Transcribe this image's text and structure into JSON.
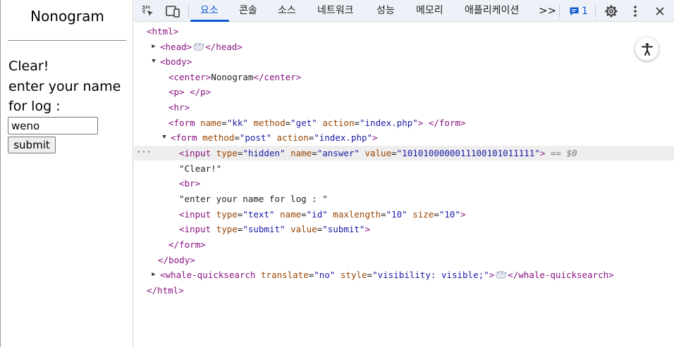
{
  "page": {
    "title": "Nonogram",
    "status": "Clear!",
    "prompt_line1": "enter your name",
    "prompt_line2": "for log :",
    "name_value": "weno",
    "submit_label": "submit"
  },
  "devtools": {
    "tabs": [
      "요소",
      "콘솔",
      "소스",
      "네트워크",
      "성능",
      "메모리",
      "애플리케이션"
    ],
    "active_tab": "요소",
    "more_tabs_icon": ">>",
    "issues_count": "1",
    "icons": [
      "inspect-element-icon",
      "device-toolbar-icon",
      "more-tabs-icon",
      "issues-icon",
      "settings-gear-icon",
      "kebab-menu-icon",
      "close-icon",
      "accessibility-icon"
    ],
    "accent_color": "#0b57d0"
  },
  "dom": {
    "html_open": "<html>",
    "head_open": "<head>",
    "head_close": "</head>",
    "body_open": "<body>",
    "center_open": "<center>",
    "center_text": "Nonogram",
    "center_close": "</center>",
    "p_open": "<p>",
    "p_close": "</p>",
    "hr": "<hr>",
    "form1_open": "<form",
    "form1_attr1_name": "name",
    "form1_attr1_value": "\"kk\"",
    "form1_attr2_name": "method",
    "form1_attr2_value": "\"get\"",
    "form1_attr3_name": "action",
    "form1_attr3_value": "\"index.php\"",
    "form_tag_end": ">",
    "form_close": "</form>",
    "form2_open": "<form",
    "form2_attr1_name": "method",
    "form2_attr1_value": "\"post\"",
    "form2_attr2_name": "action",
    "form2_attr2_value": "\"index.php\"",
    "input_open": "<input",
    "type_attr": "type",
    "hidden_value": "\"hidden\"",
    "name_attr": "name",
    "answer_value": "\"answer\"",
    "value_attr": "value",
    "answer_bits": "\"1010100000011100101011111\"",
    "selected_marker": "== $0",
    "clear_text": "\"Clear!\"",
    "br": "<br>",
    "log_text": "\"enter your name for log : \"",
    "text_value": "\"text\"",
    "id_value": "\"id\"",
    "maxlength_attr": "maxlength",
    "maxlength_value": "\"10\"",
    "size_attr": "size",
    "size_value": "\"10\"",
    "submit_type": "\"submit\"",
    "submit_value": "\"submit\"",
    "body_close": "</body>",
    "whale_open": "<whale-quicksearch",
    "translate_attr": "translate",
    "translate_value": "\"no\"",
    "style_attr": "style",
    "style_value": "\"visibility: visible;\"",
    "whale_close": "</whale-quicksearch>",
    "html_close": "</html>"
  }
}
